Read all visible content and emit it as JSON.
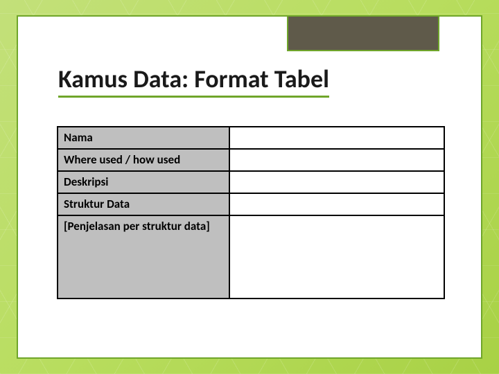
{
  "title": "Kamus Data: Format Tabel",
  "rows": {
    "r0": {
      "label": "Nama",
      "value": ""
    },
    "r1": {
      "label": "Where used / how used",
      "value": ""
    },
    "r2": {
      "label": "Deskripsi",
      "value": ""
    },
    "r3": {
      "label": "Struktur Data",
      "value": ""
    },
    "r4": {
      "label": "[Penjelasan per struktur data]",
      "value": ""
    }
  }
}
